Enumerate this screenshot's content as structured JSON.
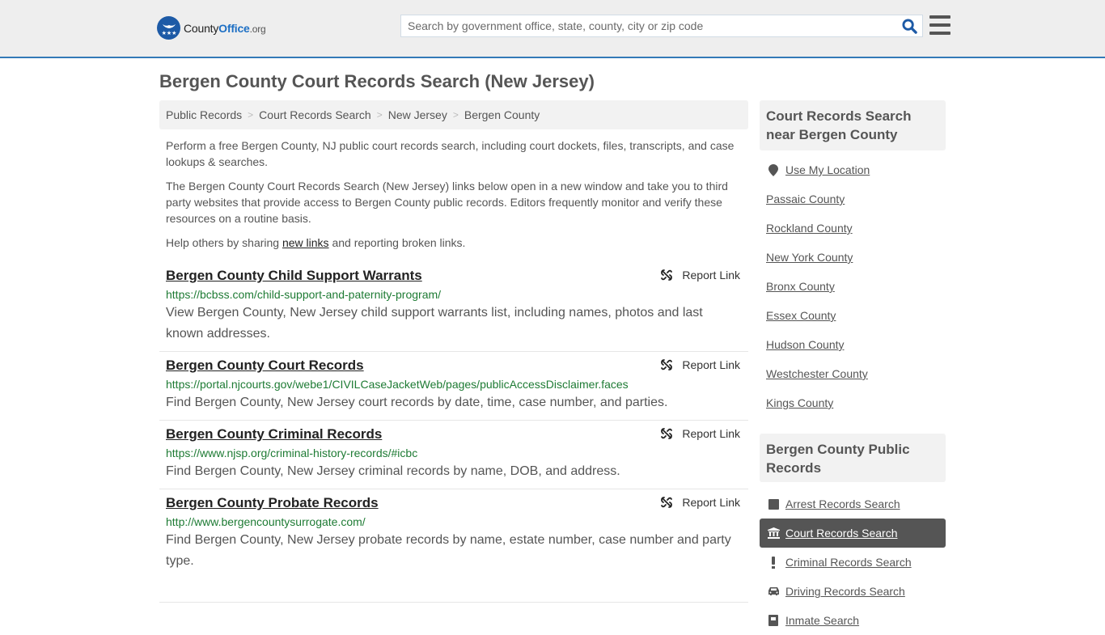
{
  "header": {
    "logo": {
      "county": "County",
      "office": "Office",
      "org": ".org"
    },
    "search_placeholder": "Search by government office, state, county, city or zip code",
    "search_value": "",
    "brand_color": "#337ab7",
    "search_icon_color": "#1d5aa6"
  },
  "page_title": "Bergen County Court Records Search (New Jersey)",
  "breadcrumb": [
    "Public Records",
    "Court Records Search",
    "New Jersey",
    "Bergen County"
  ],
  "intro": {
    "p1": "Perform a free Bergen County, NJ public court records search, including court dockets, files, transcripts, and case lookups & searches.",
    "p2": "The Bergen County Court Records Search (New Jersey) links below open in a new window and take you to third party websites that provide access to Bergen County public records. Editors frequently monitor and verify these resources on a routine basis.",
    "p3_before": "Help others by sharing ",
    "p3_link": "new links",
    "p3_after": " and reporting broken links."
  },
  "results": [
    {
      "title": "Bergen County Child Support Warrants",
      "url": "https://bcbss.com/child-support-and-paternity-program/",
      "description": "View Bergen County, New Jersey child support warrants list, including names, photos and last known addresses.",
      "report_label": "Report Link"
    },
    {
      "title": "Bergen County Court Records",
      "url": "https://portal.njcourts.gov/webe1/CIVILCaseJacketWeb/pages/publicAccessDisclaimer.faces",
      "description": "Find Bergen County, New Jersey court records by date, time, case number, and parties.",
      "report_label": "Report Link"
    },
    {
      "title": "Bergen County Criminal Records",
      "url": "https://www.njsp.org/criminal-history-records/#icbc",
      "description": "Find Bergen County, New Jersey criminal records by name, DOB, and address.",
      "report_label": "Report Link"
    },
    {
      "title": "Bergen County Probate Records",
      "url": "http://www.bergencountysurrogate.com/",
      "description": "Find Bergen County, New Jersey probate records by name, estate number, case number and party type.",
      "report_label": "Report Link"
    }
  ],
  "sidebar": {
    "nearby_title": "Court Records Search near Bergen County",
    "use_location": "Use My Location",
    "nearby": [
      "Passaic County",
      "Rockland County",
      "New York County",
      "Bronx County",
      "Essex County",
      "Hudson County",
      "Westchester County",
      "Kings County"
    ],
    "public_records_title": "Bergen County Public Records",
    "public_records": [
      {
        "label": "Arrest Records Search",
        "icon": "square-icon",
        "active": false
      },
      {
        "label": "Court Records Search",
        "icon": "courthouse-icon",
        "active": true
      },
      {
        "label": "Criminal Records Search",
        "icon": "exclamation-icon",
        "active": false
      },
      {
        "label": "Driving Records Search",
        "icon": "car-icon",
        "active": false
      },
      {
        "label": "Inmate Search",
        "icon": "id-card-icon",
        "active": false
      }
    ]
  }
}
